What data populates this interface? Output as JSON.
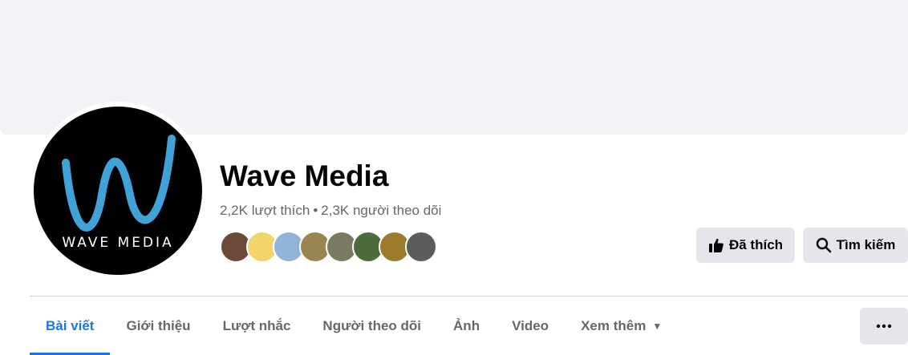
{
  "page": {
    "name": "Wave Media",
    "logo_text": "WAVE MEDIA",
    "likes": "2,2K lượt thích",
    "separator": "•",
    "followers": "2,3K người theo dõi"
  },
  "actions": {
    "liked_label": "Đã thích",
    "search_label": "Tìm kiếm",
    "more_icon": "ellipsis-icon"
  },
  "friend_avatars": [
    {
      "color": "#6b4a3a"
    },
    {
      "color": "#f2d46b"
    },
    {
      "color": "#8fb4d8"
    },
    {
      "color": "#9a8552"
    },
    {
      "color": "#7d7a62"
    },
    {
      "color": "#4e6b3d"
    },
    {
      "color": "#9c7b2c"
    },
    {
      "color": "#5c5c5c"
    }
  ],
  "tabs": [
    {
      "label": "Bài viết",
      "active": true
    },
    {
      "label": "Giới thiệu",
      "active": false
    },
    {
      "label": "Lượt nhắc",
      "active": false
    },
    {
      "label": "Người theo dõi",
      "active": false
    },
    {
      "label": "Ảnh",
      "active": false
    },
    {
      "label": "Video",
      "active": false
    },
    {
      "label": "Xem thêm",
      "active": false
    }
  ],
  "colors": {
    "accent": "#1b74e4",
    "button_bg": "#e4e6eb",
    "cover_bg": "#f0f2f5",
    "logo_wave": "#3fa3d8"
  }
}
